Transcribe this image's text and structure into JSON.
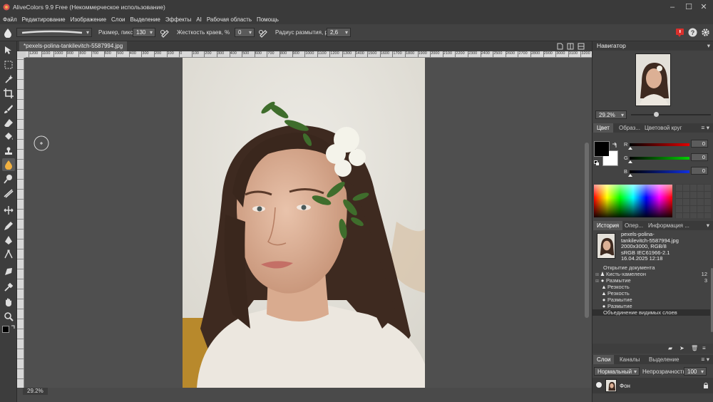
{
  "app": {
    "title": "AliveColors 9.9 Free (Некоммерческое использование)"
  },
  "menu": [
    "Файл",
    "Редактирование",
    "Изображение",
    "Слои",
    "Выделение",
    "Эффекты",
    "AI",
    "Рабочая область",
    "Помощь"
  ],
  "options": {
    "size_label": "Размер, пикс",
    "size_value": "130",
    "hardness_label": "Жесткость краев, %",
    "hardness_value": "0",
    "blur_label": "Радиус размытия, px",
    "blur_value": "2,6"
  },
  "document": {
    "tab_title": "*pexels-polina-tankilevitch-5587994.jpg",
    "zoom_status": "29.2%"
  },
  "ruler_h": [
    "1200",
    "1100",
    "1000",
    "900",
    "800",
    "700",
    "600",
    "500",
    "400",
    "300",
    "200",
    "100",
    "0",
    "100",
    "200",
    "300",
    "400",
    "500",
    "600",
    "700",
    "800",
    "900",
    "1000",
    "1100",
    "1200",
    "1300",
    "1400",
    "1500",
    "1600",
    "1700",
    "1800",
    "1900",
    "2000",
    "2100",
    "2200",
    "2300",
    "2400",
    "2500",
    "2600",
    "2700",
    "2800",
    "2900",
    "3000",
    "3100",
    "3200"
  ],
  "ruler_v": [
    "0",
    "1",
    "2",
    "3",
    "4",
    "5",
    "6",
    "7",
    "8",
    "9",
    "10",
    "11",
    "12",
    "13",
    "14",
    "15",
    "16",
    "17",
    "18",
    "19",
    "20",
    "21",
    "22",
    "23",
    "24",
    "25",
    "26",
    "27",
    "28",
    "29",
    "30",
    "31",
    "32"
  ],
  "navigator": {
    "title": "Навигатор",
    "zoom": "29.2%"
  },
  "color_panel": {
    "tabs": [
      "Цвет",
      "Образ...",
      "Цветовой круг"
    ],
    "r_label": "R",
    "g_label": "G",
    "b_label": "B",
    "r_value": "0",
    "g_value": "0",
    "b_value": "0",
    "fg_color": "#000000",
    "bg_color": "#ffffff"
  },
  "history_panel": {
    "tabs": [
      "История",
      "Опер...",
      "Информация ..."
    ],
    "file_info": [
      "pexels-polina-",
      "tankilevitch-5587994.jpg",
      "2000x3000, RGB/8",
      "sRGB IEC61966-2.1",
      "16.04.2025 12:18"
    ],
    "items": [
      {
        "label": "Открытие документа",
        "count": "",
        "icon": ""
      },
      {
        "label": "Кисть-хамелеон",
        "count": "12",
        "icon": "stamp-icon"
      },
      {
        "label": "Размытие",
        "count": "3",
        "icon": "drop-icon"
      },
      {
        "label": "Резкость",
        "count": "",
        "icon": "triangle-icon"
      },
      {
        "label": "Резкость",
        "count": "",
        "icon": "triangle-icon"
      },
      {
        "label": "Размытие",
        "count": "",
        "icon": "drop-icon"
      },
      {
        "label": "Размытие",
        "count": "",
        "icon": "drop-icon"
      },
      {
        "label": "Объединение видимых слоев",
        "count": "",
        "icon": ""
      }
    ]
  },
  "layers_panel": {
    "tabs": [
      "Слои",
      "Каналы",
      "Выделение"
    ],
    "blend_mode": "Нормальный",
    "opacity_label": "Непрозрачность",
    "opacity_value": "100",
    "layer_name": "Фон"
  }
}
